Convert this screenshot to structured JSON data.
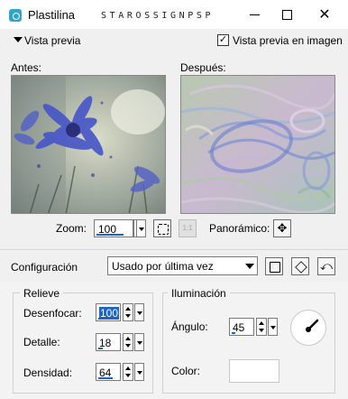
{
  "window": {
    "title": "Plastilina",
    "watermark": "STAROSSIGNPSP",
    "minimize_icon": "minimize-icon",
    "maximize_icon": "maximize-icon",
    "close_icon": "close-icon",
    "close_glyph": "✕"
  },
  "preview": {
    "toggle_label": "Vista previa",
    "checkbox_label": "Vista previa en imagen",
    "checkbox_checked": true,
    "check_glyph": "✓",
    "before_label": "Antes:",
    "after_label": "Después:"
  },
  "zoom": {
    "label": "Zoom:",
    "value": "100",
    "one_to_one": "1:1",
    "pan_label": "Panorámico:",
    "pan_glyph": "✥"
  },
  "presets": {
    "label": "Configuración",
    "selected": "Usado por última vez",
    "reset_glyph": "⤺"
  },
  "relief": {
    "title": "Relieve",
    "blur_label": "Desenfocar:",
    "blur_value": "100",
    "detail_label": "Detalle:",
    "detail_value": "18",
    "density_label": "Densidad:",
    "density_value": "64"
  },
  "lighting": {
    "title": "Iluminación",
    "angle_label": "Ángulo:",
    "angle_value": "45",
    "color_label": "Color:",
    "color_value": "#ffffff"
  }
}
